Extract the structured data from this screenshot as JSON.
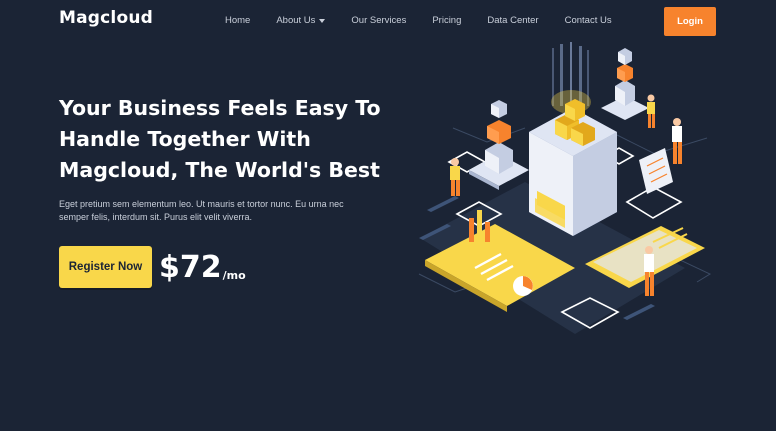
{
  "header": {
    "logo": "Magcloud",
    "nav": [
      {
        "label": "Home"
      },
      {
        "label": "About Us",
        "has_dropdown": true
      },
      {
        "label": "Our Services"
      },
      {
        "label": "Pricing"
      },
      {
        "label": "Data Center"
      },
      {
        "label": "Contact Us"
      }
    ],
    "login_label": "Login"
  },
  "hero": {
    "title_lines": [
      "Your Business Feels Easy To",
      "Handle Together With",
      "Magcloud, The World's Best"
    ],
    "description_lines": [
      "Eget pretium sem elementum leo. Ut mauris et tortor nunc. Eu urna nec",
      "semper felis, interdum sit. Purus elit velit viverra."
    ],
    "register_label": "Register Now",
    "price": "$72",
    "price_unit": "/mo"
  },
  "colors": {
    "background": "#1b2435",
    "login_button": "#f7832d",
    "register_button": "#f9d74a",
    "accent_orange": "#f7832d",
    "accent_yellow": "#f9d74a"
  }
}
